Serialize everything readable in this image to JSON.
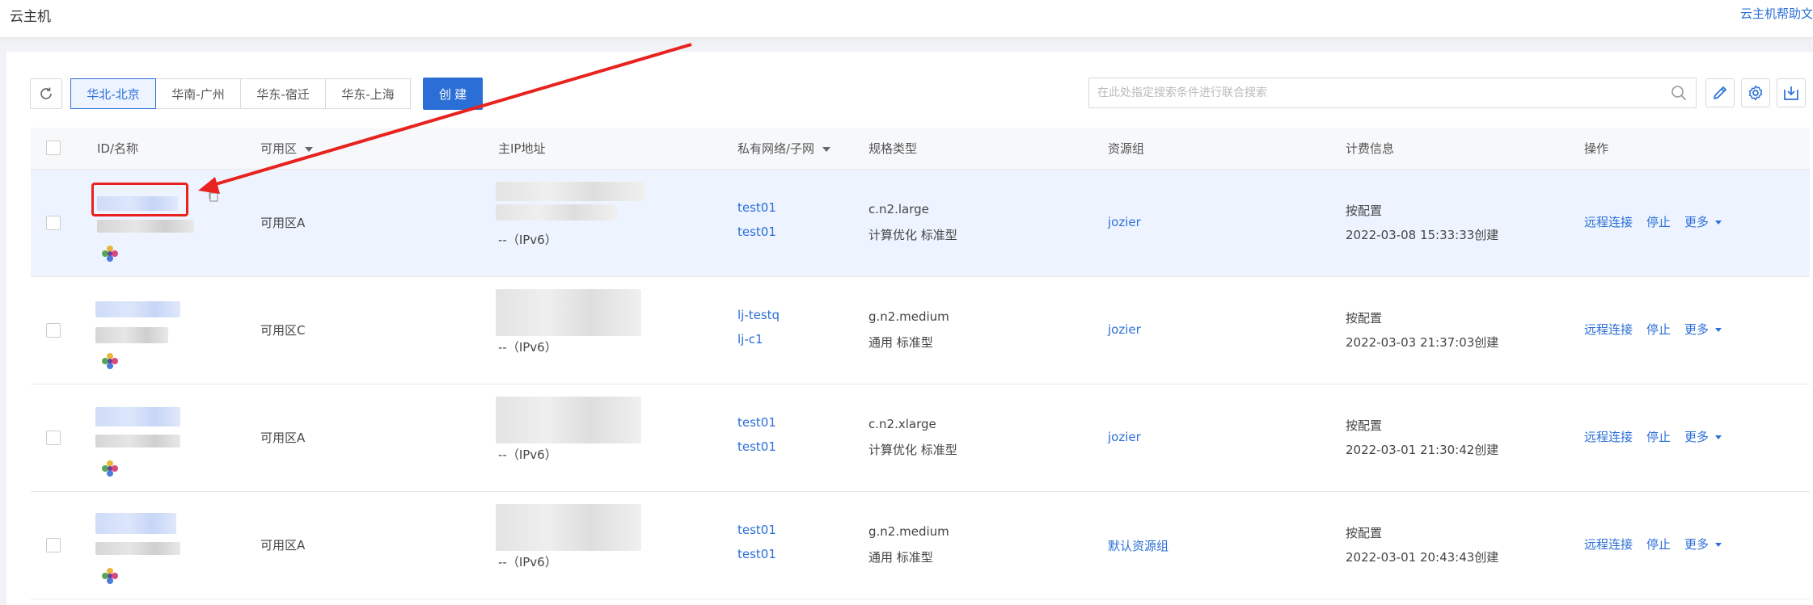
{
  "header": {
    "title": "云主机",
    "help_link": "云主机帮助文"
  },
  "toolbar": {
    "regions": [
      "华北-北京",
      "华南-广州",
      "华东-宿迁",
      "华东-上海"
    ],
    "active_region": "华北-北京",
    "create_label": "创 建",
    "search_placeholder": "在此处指定搜索条件进行联合搜索"
  },
  "table": {
    "columns": {
      "name": "ID/名称",
      "zone": "可用区",
      "ip": "主IP地址",
      "network": "私有网络/子网",
      "spec": "规格类型",
      "group": "资源组",
      "billing": "计费信息",
      "ops": "操作"
    },
    "rows": [
      {
        "zone": "可用区A",
        "ipv6": "--（IPv6）",
        "net1": "test01",
        "net2": "test01",
        "spec": "c.n2.large",
        "spec_sub": "计算优化 标准型",
        "group": "jozier",
        "billing": "按配置",
        "created": "2022-03-08 15:33:33创建"
      },
      {
        "zone": "可用区C",
        "ipv6": "--（IPv6）",
        "net1": "lj-testq",
        "net2": "lj-c1",
        "spec": "g.n2.medium",
        "spec_sub": "通用 标准型",
        "group": "jozier",
        "billing": "按配置",
        "created": "2022-03-03 21:37:03创建"
      },
      {
        "zone": "可用区A",
        "ipv6": "--（IPv6）",
        "net1": "test01",
        "net2": "test01",
        "spec": "c.n2.xlarge",
        "spec_sub": "计算优化 标准型",
        "group": "jozier",
        "billing": "按配置",
        "created": "2022-03-01 21:30:42创建"
      },
      {
        "zone": "可用区A",
        "ipv6": "--（IPv6）",
        "net1": "test01",
        "net2": "test01",
        "spec": "g.n2.medium",
        "spec_sub": "通用 标准型",
        "group": "默认资源组",
        "billing": "按配置",
        "created": "2022-03-01 20:43:43创建"
      }
    ],
    "operations": {
      "connect": "远程连接",
      "stop": "停止",
      "more": "更多"
    }
  },
  "colors": {
    "accent": "#2b6fd6",
    "annotation": "#e8231f"
  }
}
